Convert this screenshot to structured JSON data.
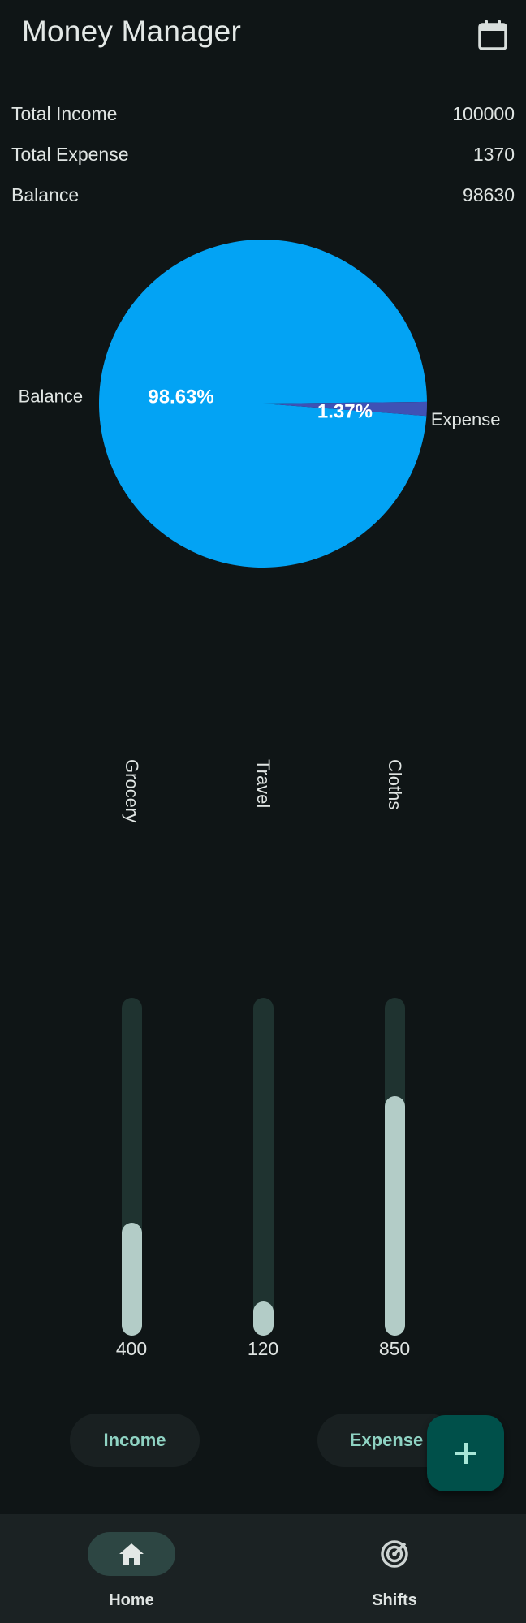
{
  "app_bar": {
    "title": "Money Manager",
    "calendar_icon": "calendar-icon"
  },
  "summary": {
    "income_label": "Total Income",
    "income_value": "100000",
    "expense_label": "Total Expense",
    "expense_value": "1370",
    "balance_label": "Balance",
    "balance_value": "98630"
  },
  "chart_data": [
    {
      "type": "pie",
      "labels": [
        "Balance",
        "Expense"
      ],
      "values": [
        98.63,
        1.37
      ],
      "value_labels": [
        "98.63%",
        "1.37%"
      ],
      "colors": [
        "#03a3f4",
        "#3f51b5"
      ]
    },
    {
      "type": "bar",
      "categories": [
        "Grocery",
        "Travel",
        "Cloths"
      ],
      "values": [
        400,
        120,
        850
      ],
      "value_labels": [
        "400",
        "120",
        "850"
      ],
      "ylim": [
        0,
        1200
      ],
      "colors": {
        "track": "#1f3330",
        "fill": "#b3ccc7"
      }
    }
  ],
  "actions": {
    "income_label": "Income",
    "expense_label": "Expense",
    "add_icon": "plus-icon"
  },
  "nav": {
    "home_label": "Home",
    "home_icon": "home-icon",
    "shifts_label": "Shifts",
    "shifts_icon": "target-icon"
  },
  "colors": {
    "background": "#0f1516",
    "accent": "#8fd3c3",
    "fab": "#00504a",
    "nav_background": "#1b2223"
  }
}
